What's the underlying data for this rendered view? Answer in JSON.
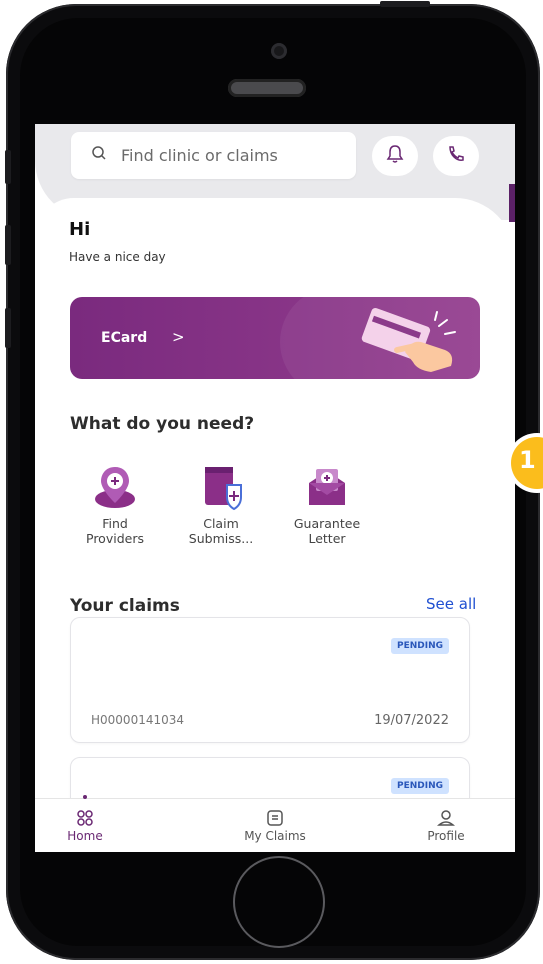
{
  "search": {
    "placeholder": "Find clinic or claims",
    "icon": "search-icon"
  },
  "header_icons": {
    "notifications": "bell-icon",
    "call": "phone-icon"
  },
  "greeting": {
    "title": "Hi",
    "subtitle": "Have a nice day"
  },
  "ecard": {
    "label": "ECard",
    "arrow": ">"
  },
  "services": {
    "section_title": "What do you need?",
    "items": [
      {
        "label_line1": "Find",
        "label_line2": "Providers",
        "icon": "map-pin-plus-icon"
      },
      {
        "label_line1": "Claim",
        "label_line2": "Submiss...",
        "icon": "shield-document-icon"
      },
      {
        "label_line1": "Guarantee",
        "label_line2": "Letter",
        "icon": "letter-plus-icon"
      }
    ]
  },
  "claims": {
    "title": "Your claims",
    "see_all": "See all",
    "items": [
      {
        "status": "PENDING",
        "code": "H00000141034",
        "date": "19/07/2022"
      },
      {
        "status": "PENDING",
        "code": "",
        "date": ""
      }
    ]
  },
  "callout": {
    "number": "1"
  },
  "bottom_nav": [
    {
      "label": "Home",
      "icon": "home-icon",
      "active": true
    },
    {
      "label": "My Claims",
      "icon": "claims-icon",
      "active": false
    },
    {
      "label": "Profile",
      "icon": "profile-icon",
      "active": false
    }
  ],
  "colors": {
    "brand_purple": "#7a2a7e",
    "accent_blue": "#1f4fd1",
    "callout_yellow": "#fbbd1c"
  }
}
